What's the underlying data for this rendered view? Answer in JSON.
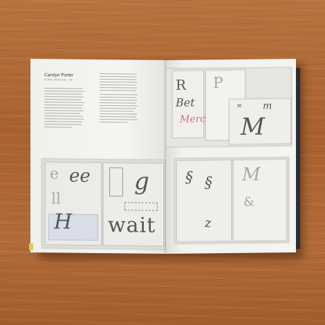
{
  "book": {
    "left_page": {
      "heading": "Carolyn Porter",
      "subheading": "St Paul, Minnesota · US"
    },
    "artwork_text": {
      "ee": "ee",
      "wait": "wait",
      "merci": "Merci",
      "ampersand": "&",
      "initial_m": "M",
      "initial_h": "H",
      "initial_z": "z",
      "treble": "§"
    }
  },
  "colors": {
    "table": "#b06a3a",
    "page": "#f4f3ef",
    "cover": "#2a2d31",
    "accent_pink": "#d66a8a"
  }
}
